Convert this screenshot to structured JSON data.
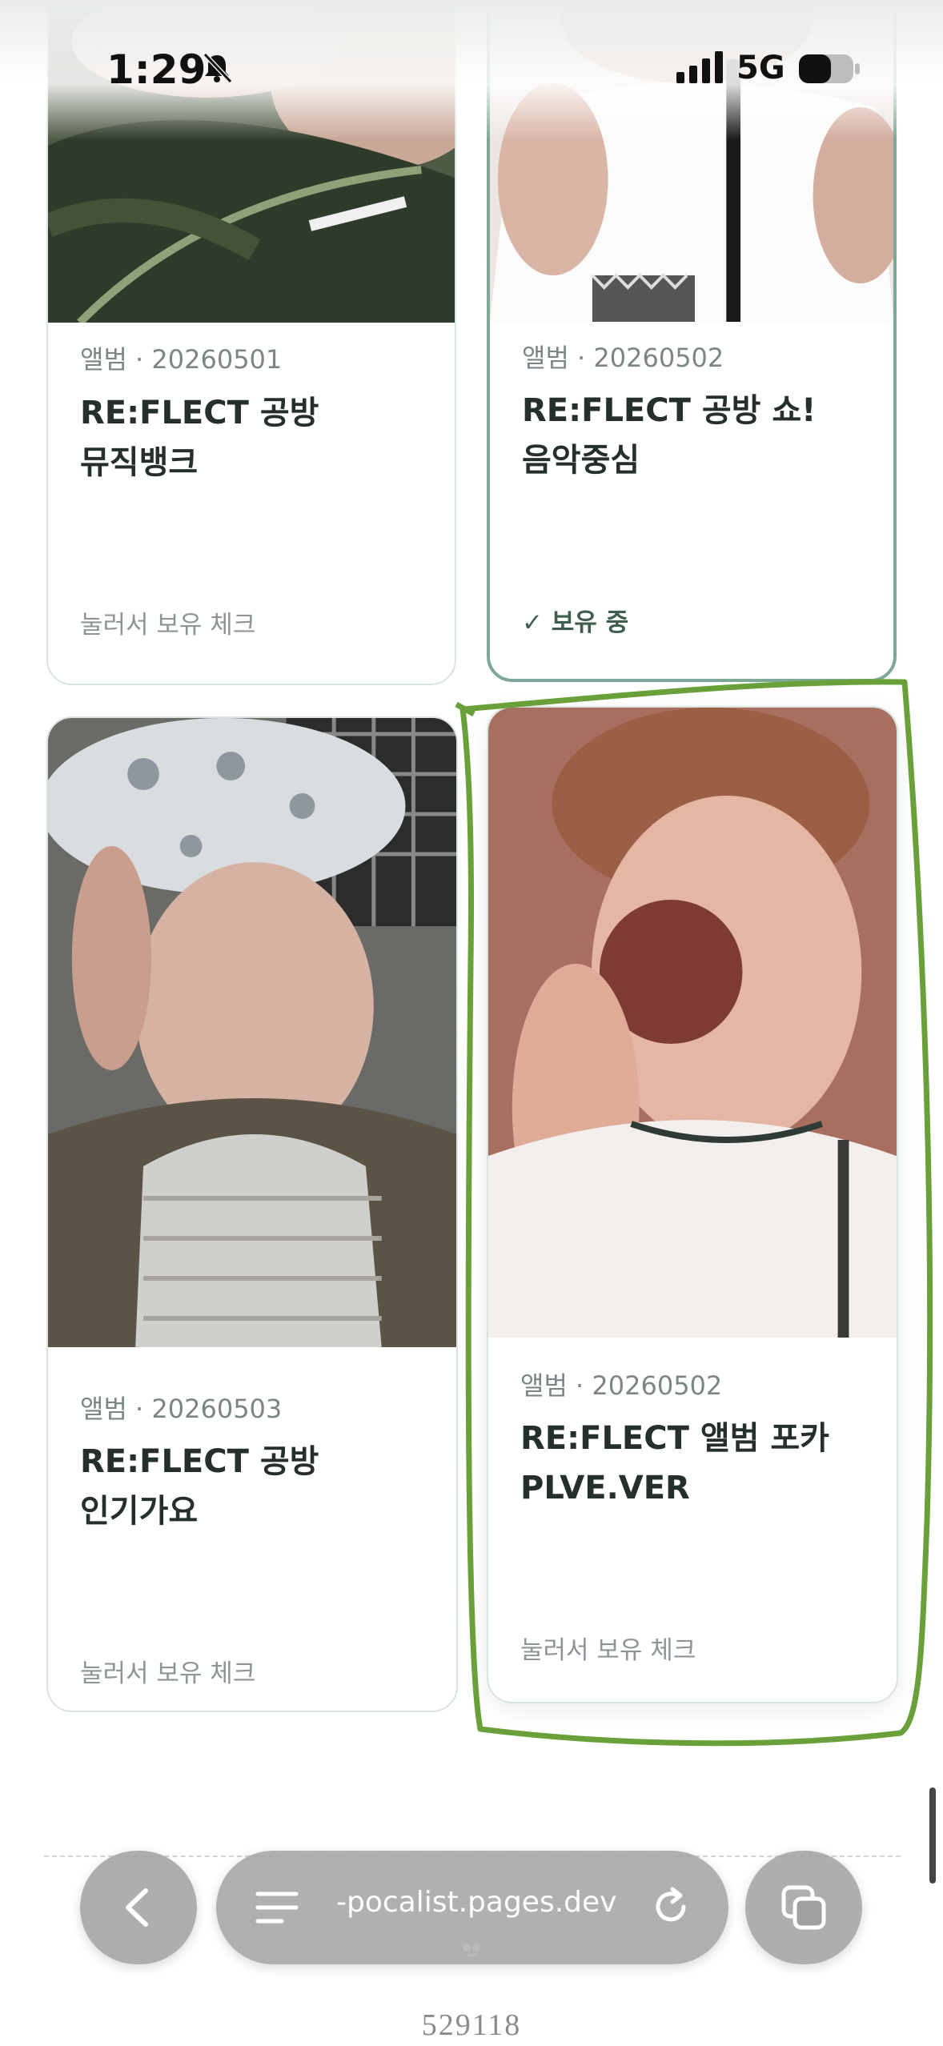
{
  "status_bar": {
    "time": "1:29",
    "network": "5G"
  },
  "cards": [
    {
      "meta": "앨범 · 20260501",
      "title_line1": "RE:FLECT 공방",
      "title_line2": "뮤직뱅크",
      "footer": "눌러서 보유 체크",
      "owned": false
    },
    {
      "meta": "앨범 · 20260502",
      "title_line1": "RE:FLECT 공방 쇼!",
      "title_line2": "음악중심",
      "footer": "✓ 보유 중",
      "owned": true
    },
    {
      "meta": "앨범 · 20260503",
      "title_line1": "RE:FLECT 공방",
      "title_line2": "인기가요",
      "footer": "눌러서 보유 체크",
      "owned": false
    },
    {
      "meta": "앨범 · 20260502",
      "title_line1": "RE:FLECT 앨범 포카",
      "title_line2": "PLVE.VER",
      "footer": "눌러서 보유 체크",
      "owned": false
    }
  ],
  "browser": {
    "url": "-pocalist.pages.dev"
  },
  "footer_number": "529118",
  "colors": {
    "accent_green": "#6aa03a",
    "owned_border": "#7ea896",
    "owned_text": "#3e5f4d"
  }
}
